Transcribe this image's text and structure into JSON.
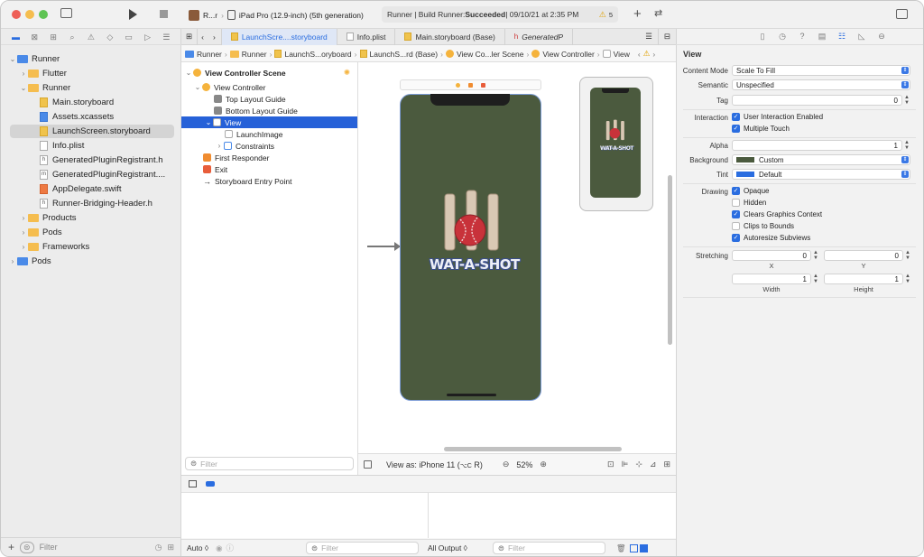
{
  "toolbar": {
    "scheme_app": "R...r",
    "scheme_device": "iPad Pro (12.9-inch) (5th generation)",
    "status_prefix": "Runner | Build Runner: ",
    "status_result": "Succeeded",
    "status_time": " | 09/10/21 at 2:35 PM",
    "warning_count": "5"
  },
  "navigator": {
    "items": [
      {
        "label": "Runner"
      },
      {
        "label": "Flutter"
      },
      {
        "label": "Runner"
      },
      {
        "label": "Main.storyboard"
      },
      {
        "label": "Assets.xcassets"
      },
      {
        "label": "LaunchScreen.storyboard"
      },
      {
        "label": "Info.plist"
      },
      {
        "label": "GeneratedPluginRegistrant.h"
      },
      {
        "label": "GeneratedPluginRegistrant...."
      },
      {
        "label": "AppDelegate.swift"
      },
      {
        "label": "Runner-Bridging-Header.h"
      },
      {
        "label": "Products"
      },
      {
        "label": "Pods"
      },
      {
        "label": "Frameworks"
      },
      {
        "label": "Pods"
      }
    ],
    "filter_placeholder": "Filter"
  },
  "tabs": [
    {
      "label": "LaunchScre....storyboard"
    },
    {
      "label": "Info.plist"
    },
    {
      "label": "Main.storyboard (Base)"
    },
    {
      "label": "GeneratedP"
    }
  ],
  "jumpbar": [
    "Runner",
    "Runner",
    "LaunchS...oryboard",
    "LaunchS...rd (Base)",
    "View Co...ler Scene",
    "View Controller",
    "View"
  ],
  "outline": {
    "items": [
      {
        "label": "View Controller Scene"
      },
      {
        "label": "View Controller"
      },
      {
        "label": "Top Layout Guide"
      },
      {
        "label": "Bottom Layout Guide"
      },
      {
        "label": "View"
      },
      {
        "label": "LaunchImage"
      },
      {
        "label": "Constraints"
      },
      {
        "label": "First Responder"
      },
      {
        "label": "Exit"
      },
      {
        "label": "Storyboard Entry Point"
      }
    ],
    "filter_placeholder": "Filter"
  },
  "canvas": {
    "logo_text": "WAT-A-SHOT",
    "view_as_label": "View as: iPhone 11 (",
    "view_as_shortcut": "⌥C",
    "view_as_suffix": "R)",
    "zoom": "52%",
    "phone_color": "#4b5a3e"
  },
  "debug": {
    "auto_label": "Auto ◊",
    "filter_left": "Filter",
    "output_label": "All Output ◊",
    "filter_right": "Filter"
  },
  "inspector": {
    "title": "View",
    "content_mode_label": "Content Mode",
    "content_mode_value": "Scale To Fill",
    "semantic_label": "Semantic",
    "semantic_value": "Unspecified",
    "tag_label": "Tag",
    "tag_value": "0",
    "interaction_label": "Interaction",
    "user_interaction": "User Interaction Enabled",
    "multiple_touch": "Multiple Touch",
    "alpha_label": "Alpha",
    "alpha_value": "1",
    "background_label": "Background",
    "background_value": "Custom",
    "background_color": "#4b5a3e",
    "tint_label": "Tint",
    "tint_value": "Default",
    "tint_color": "#2a6de0",
    "drawing_label": "Drawing",
    "opaque": "Opaque",
    "hidden": "Hidden",
    "clears_graphics": "Clears Graphics Context",
    "clips_to_bounds": "Clips to Bounds",
    "autoresize": "Autoresize Subviews",
    "stretching_label": "Stretching",
    "stretch_x": "0",
    "stretch_y": "0",
    "stretch_width": "1",
    "stretch_height": "1",
    "x_label": "X",
    "y_label": "Y",
    "width_label": "Width",
    "height_label": "Height"
  }
}
